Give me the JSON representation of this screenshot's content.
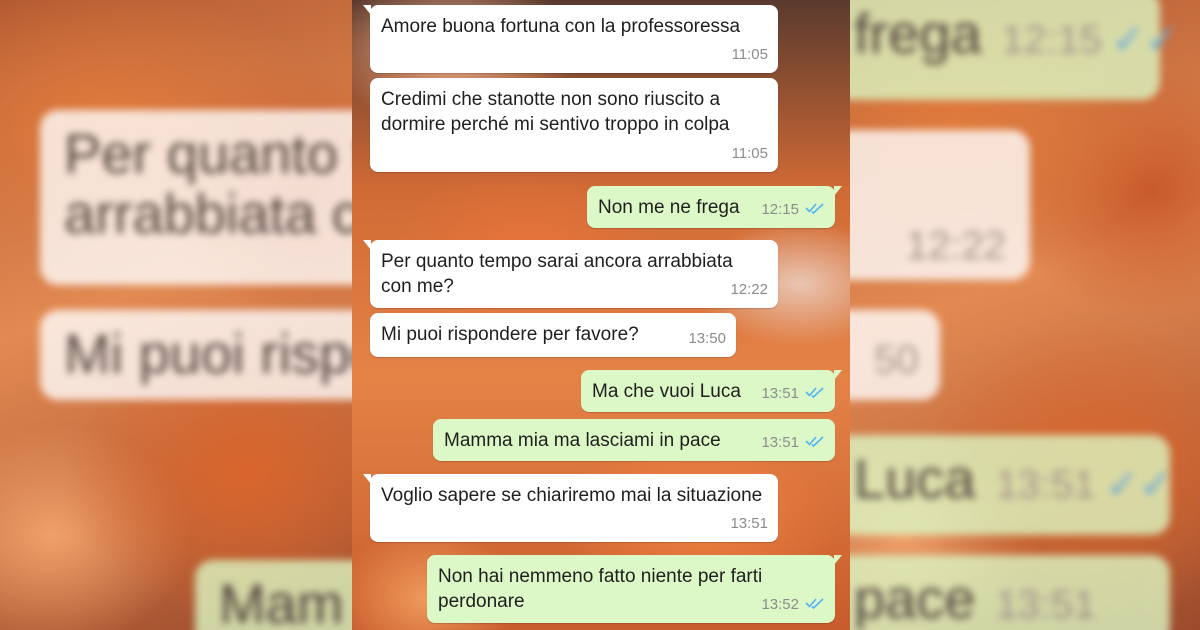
{
  "colors": {
    "incoming_bubble": "#ffffff",
    "outgoing_bubble": "#dcf8c6",
    "read_tick": "#4fb3f6"
  },
  "messages": [
    {
      "direction": "in",
      "text": "Amore buona fortuna con la professoressa",
      "time": "11:05"
    },
    {
      "direction": "in",
      "text": "Credimi che stanotte non sono riuscito a dormire perché mi sentivo troppo in colpa",
      "time": "11:05"
    },
    {
      "direction": "out",
      "text": "Non me ne frega",
      "time": "12:15",
      "status": "read"
    },
    {
      "direction": "in",
      "text": "Per quanto tempo sarai ancora arrabbiata con me?",
      "time": "12:22"
    },
    {
      "direction": "in",
      "text": "Mi puoi rispondere per favore?",
      "time": "13:50"
    },
    {
      "direction": "out",
      "text": "Ma che vuoi Luca",
      "time": "13:51",
      "status": "read"
    },
    {
      "direction": "out",
      "text": "Mamma mia ma lasciami in pace",
      "time": "13:51",
      "status": "read"
    },
    {
      "direction": "in",
      "text": "Voglio sapere se chiariremo mai la situazione",
      "time": "13:51"
    },
    {
      "direction": "out",
      "text": "Non hai nemmeno fatto niente per farti perdonare",
      "time": "13:52",
      "status": "read"
    }
  ],
  "background_left": [
    {
      "text": "Per quanto te",
      "time": ""
    },
    {
      "text": "arrabbiata co",
      "time": ""
    },
    {
      "text": "Mi puoi rispo",
      "time": ""
    },
    {
      "text": "Mam",
      "time": ""
    }
  ],
  "background_right": [
    {
      "text": "frega",
      "time": "12:15"
    },
    {
      "text": "",
      "time": "12:22"
    },
    {
      "text": "",
      "time": "50"
    },
    {
      "text": "Luca",
      "time": "13:51"
    },
    {
      "text": "pace",
      "time": "13:51"
    }
  ]
}
